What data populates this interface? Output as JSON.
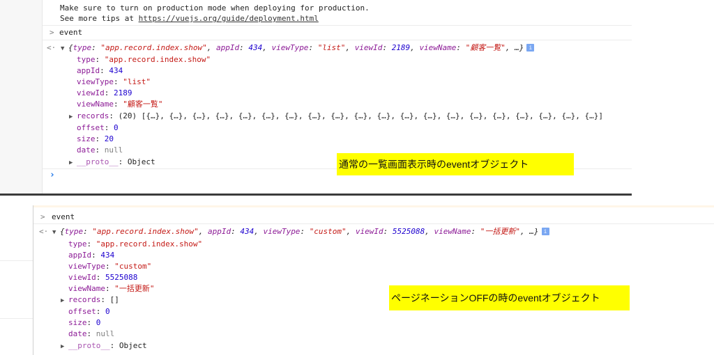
{
  "top": {
    "warning_line1": "Make sure to turn on production mode when deploying for production.",
    "warning_line2_prefix": "See more tips at ",
    "warning_link": "https://vuejs.org/guide/deployment.html",
    "prompt_symbol": ">",
    "command": "event",
    "return_symbol": "<·",
    "preview": {
      "open": "{",
      "type_key": "type",
      "type_val": "\"app.record.index.show\"",
      "appId_key": "appId",
      "appId_val": "434",
      "viewType_key": "viewType",
      "viewType_val": "\"list\"",
      "viewId_key": "viewId",
      "viewId_val": "2189",
      "viewName_key": "viewName",
      "viewName_val": "\"顧客一覧\"",
      "tail": ", …}"
    },
    "props": {
      "type_val": "\"app.record.index.show\"",
      "appId_val": "434",
      "viewType_val": "\"list\"",
      "viewId_val": "2189",
      "viewName_val": "\"顧客一覧\"",
      "records_key": "records",
      "records_val": "(20) [{…}, {…}, {…}, {…}, {…}, {…}, {…}, {…}, {…}, {…}, {…}, {…}, {…}, {…}, {…}, {…}, {…}, {…}, {…}, {…}]",
      "offset_key": "offset",
      "offset_val": "0",
      "size_key": "size",
      "size_val": "20",
      "date_key": "date",
      "date_val": "null",
      "proto_key": "__proto__",
      "proto_val": "Object"
    },
    "caption": "通常の一覧画面表示時のeventオブジェクト",
    "input_prompt": "›"
  },
  "bottom": {
    "prompt_symbol": ">",
    "command": "event",
    "return_symbol": "<·",
    "preview": {
      "open": "{",
      "type_key": "type",
      "type_val": "\"app.record.index.show\"",
      "appId_key": "appId",
      "appId_val": "434",
      "viewType_key": "viewType",
      "viewType_val": "\"custom\"",
      "viewId_key": "viewId",
      "viewId_val": "5525088",
      "viewName_key": "viewName",
      "viewName_val": "\"一括更新\"",
      "tail": ", …}"
    },
    "props": {
      "type_val": "\"app.record.index.show\"",
      "appId_val": "434",
      "viewType_val": "\"custom\"",
      "viewId_val": "5525088",
      "viewName_val": "\"一括更新\"",
      "records_key": "records",
      "records_val": "[]",
      "offset_key": "offset",
      "offset_val": "0",
      "size_key": "size",
      "size_val": "0",
      "date_key": "date",
      "date_val": "null",
      "proto_key": "__proto__",
      "proto_val": "Object"
    },
    "caption": "ページネーションOFFの時のeventオブジェクト"
  },
  "icons": {
    "info_glyph": "i",
    "expanded_glyph": "▼",
    "collapsed_glyph": "▶"
  },
  "colors": {
    "key": "#8c1b96",
    "string": "#c41a16",
    "number": "#1c00cf",
    "null": "#808080",
    "caption_bg": "#ffff00",
    "info_badge": "#7aa7f2"
  }
}
